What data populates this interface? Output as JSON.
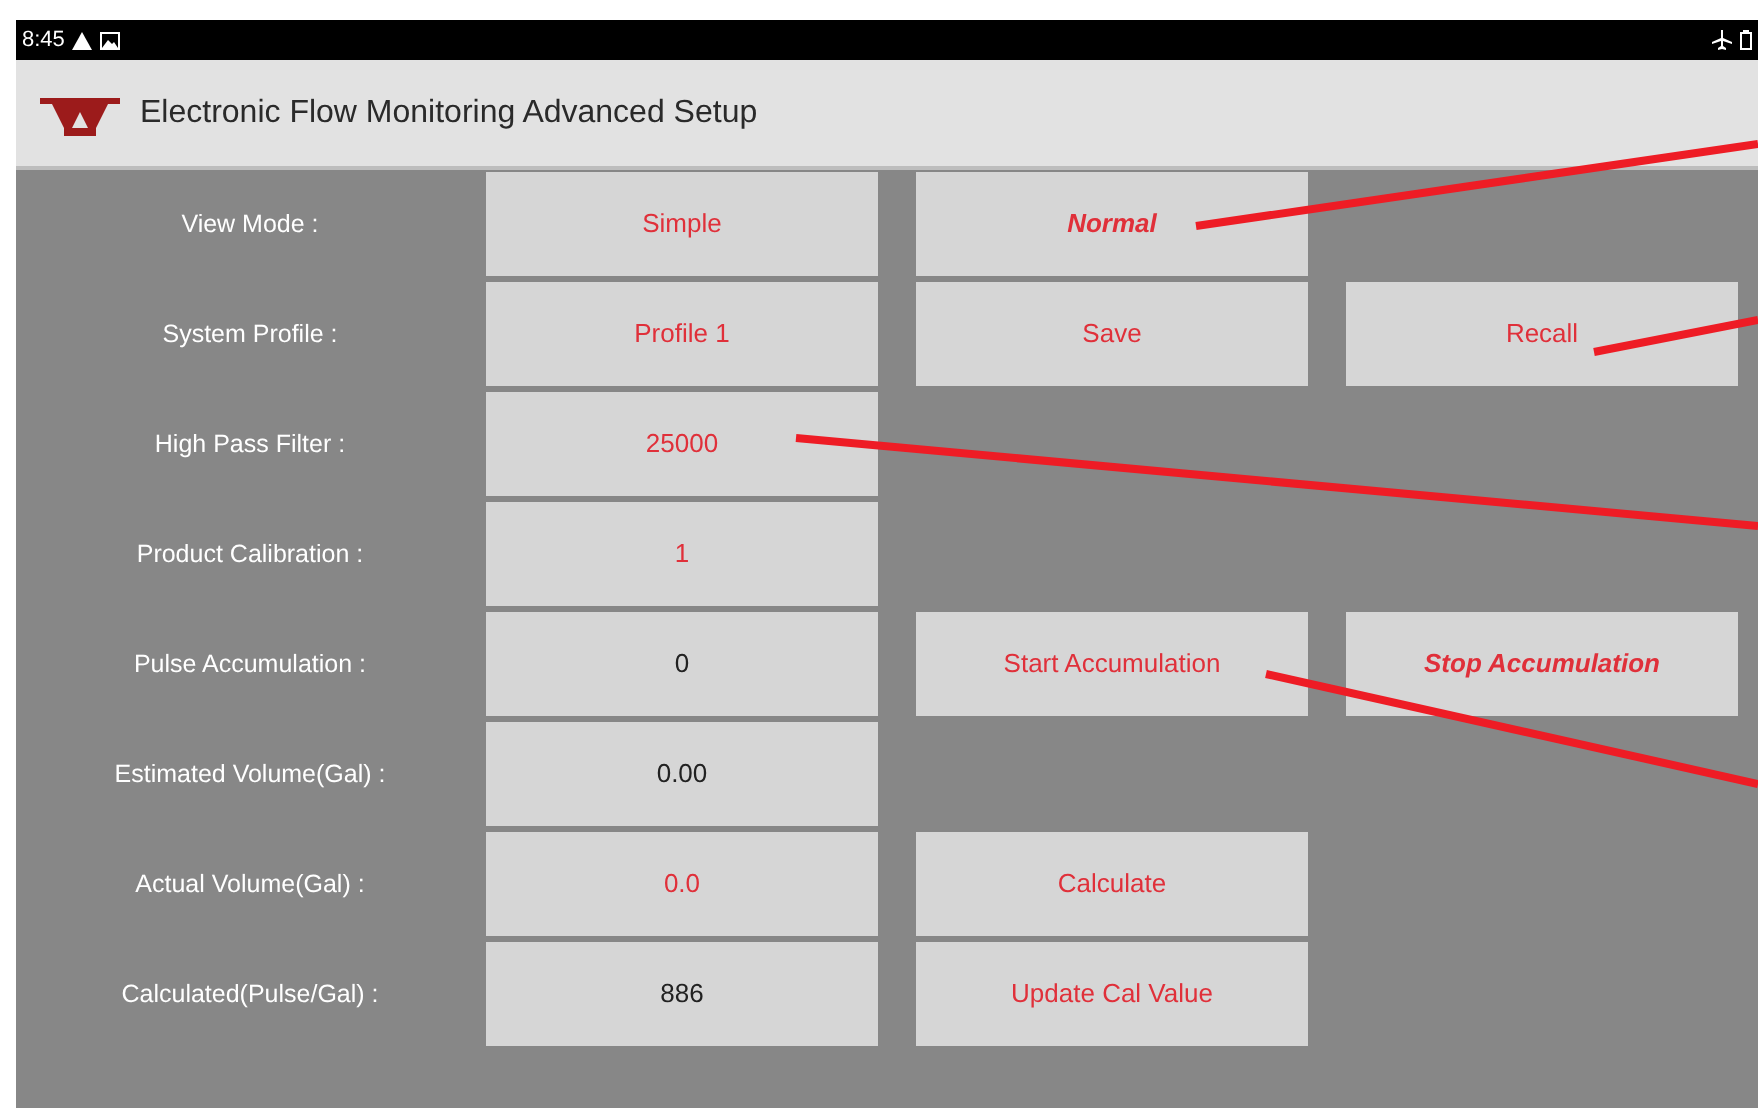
{
  "status_bar": {
    "time": "8:45"
  },
  "app_bar": {
    "title": "Electronic Flow Monitoring Advanced Setup"
  },
  "rows": [
    {
      "label": "View Mode :",
      "value": {
        "text": "Simple",
        "kind": "input"
      },
      "actions": [
        {
          "label": "Normal",
          "active": true
        }
      ]
    },
    {
      "label": "System Profile :",
      "value": {
        "text": "Profile 1",
        "kind": "input"
      },
      "actions": [
        {
          "label": "Save",
          "active": false
        },
        {
          "label": "Recall",
          "active": false
        }
      ]
    },
    {
      "label": "High Pass Filter :",
      "value": {
        "text": "25000",
        "kind": "input"
      },
      "actions": []
    },
    {
      "label": "Product Calibration :",
      "value": {
        "text": "1",
        "kind": "input"
      },
      "actions": []
    },
    {
      "label": "Pulse Accumulation :",
      "value": {
        "text": "0",
        "kind": "readout"
      },
      "actions": [
        {
          "label": "Start Accumulation",
          "active": false
        },
        {
          "label": "Stop Accumulation",
          "active": true
        }
      ]
    },
    {
      "label": "Estimated Volume(Gal) :",
      "value": {
        "text": "0.00",
        "kind": "readout"
      },
      "actions": []
    },
    {
      "label": "Actual Volume(Gal) :",
      "value": {
        "text": "0.0",
        "kind": "input"
      },
      "actions": [
        {
          "label": "Calculate",
          "active": false
        }
      ]
    },
    {
      "label": "Calculated(Pulse/Gal) :",
      "value": {
        "text": "886",
        "kind": "readout"
      },
      "actions": [
        {
          "label": "Update Cal Value",
          "active": false
        }
      ]
    }
  ]
}
